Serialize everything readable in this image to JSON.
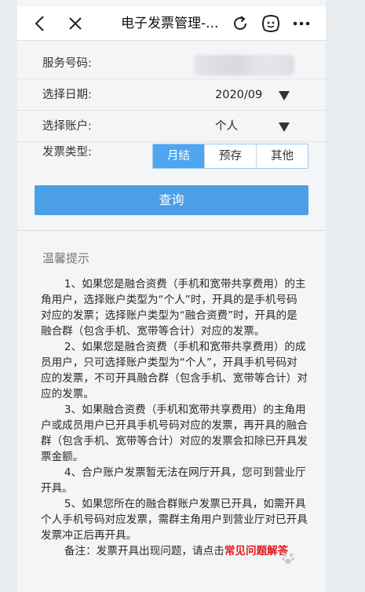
{
  "nav": {
    "title": "电子发票管理-..."
  },
  "form": {
    "service_number_label": "服务号码:",
    "service_number_value": "",
    "date_label": "选择日期:",
    "date_value": "2020/09",
    "account_label": "选择账户:",
    "account_value": "个人",
    "invoice_type_label": "发票类型:",
    "invoice_types": [
      "月结",
      "预存",
      "其他"
    ],
    "selected_invoice_type": "月结"
  },
  "query_button": "查询",
  "tips": {
    "title": "温馨提示",
    "items": [
      "1、如果您是融合资费（手机和宽带共享费用）的主角用户，选择账户类型为“个人”时，开具的是手机号码对应的发票；选择账户类型为“融合资费”时，开具的是融合群（包含手机、宽带等合计）对应的发票。",
      "2、如果您是融合资费（手机和宽带共享费用）的成员用户，只可选择账户类型为“个人”，开具手机号码对应的发票，不可开具融合群（包含手机、宽带等合计）对应的发票。",
      "3、如果融合资费（手机和宽带共享费用）的主角用户或成员用户已开具手机号码对应的发票，再开具的融合群（包含手机、宽带等合计）对应的发票会扣除已开具发票金额。",
      "4、合户账户发票暂无法在网厅开具，您可到营业厅开具。",
      "5、如果您所在的融合群账户发票已开具，如需开具个人手机号码对应发票，需群主角用户到营业厅对已开具发票冲正后再开具。"
    ],
    "note_prefix": "备注：发票开具出现问题，请点击",
    "note_link": "常见问题解答"
  },
  "colors": {
    "accent": "#4a9fe6",
    "link": "#e21a1a"
  }
}
